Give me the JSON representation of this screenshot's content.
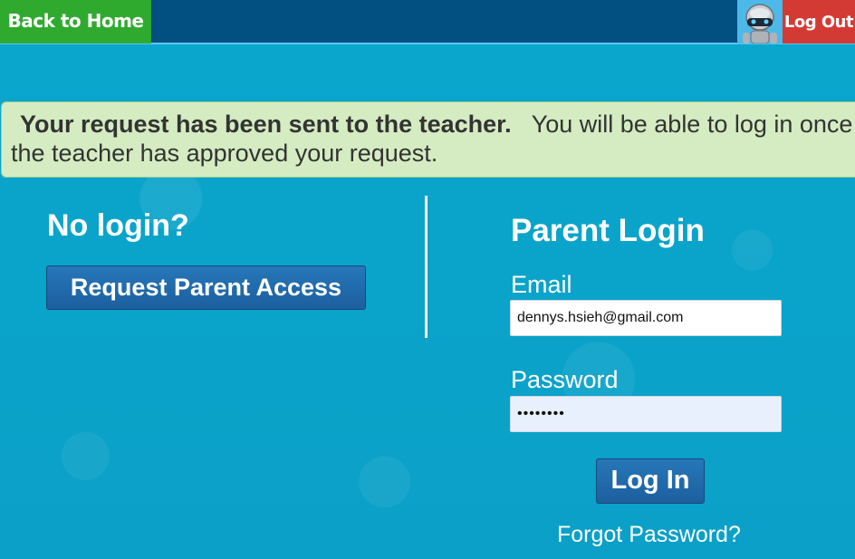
{
  "topbar": {
    "home_label": "Back to Home",
    "logout_label": "Log Out",
    "colors": {
      "bar": "#024f82",
      "home": "#2faa2f",
      "logout": "#d43a34"
    }
  },
  "notice": {
    "bold": "Your request has been sent to the teacher.",
    "text": "You will be able to log in once the teacher has approved your request."
  },
  "left": {
    "heading": "No login?",
    "request_button": "Request Parent Access"
  },
  "login": {
    "heading": "Parent Login",
    "email_label": "Email",
    "email_value": "dennys.hsieh@gmail.com",
    "password_label": "Password",
    "password_value": "12345678",
    "login_button": "Log In",
    "forgot_link": "Forgot Password?"
  },
  "icons": {
    "avatar": "robot-avatar-icon"
  }
}
